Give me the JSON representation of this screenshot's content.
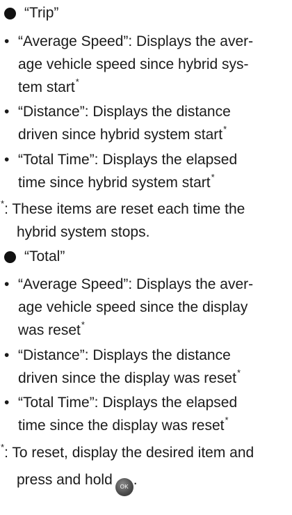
{
  "sections": [
    {
      "heading": "“Trip”",
      "items": [
        {
          "lines": [
            "“Average Speed”: Displays the aver-",
            "age vehicle speed since hybrid sys-",
            "tem start"
          ],
          "footnote_mark": "*"
        },
        {
          "lines": [
            "“Distance”: Displays the distance",
            "driven since hybrid system start"
          ],
          "footnote_mark": "*"
        },
        {
          "lines": [
            "“Total Time”: Displays the elapsed",
            "time since hybrid system start"
          ],
          "footnote_mark": "*"
        }
      ],
      "note": {
        "mark": "*",
        "lines": [
          ": These items are reset each time the",
          "hybrid system stops."
        ]
      }
    },
    {
      "heading": "“Total”",
      "items": [
        {
          "lines": [
            "“Average Speed”: Displays the aver-",
            "age vehicle speed since the display",
            "was reset"
          ],
          "footnote_mark": "*"
        },
        {
          "lines": [
            "“Distance”: Displays the distance",
            "driven since the display was reset"
          ],
          "footnote_mark": "*"
        },
        {
          "lines": [
            "“Total Time”: Displays the elapsed",
            "time since the display was reset"
          ],
          "footnote_mark": "*"
        }
      ],
      "note": {
        "mark": "*",
        "lines": [
          ": To reset, display the desired item and",
          "press and hold"
        ],
        "end_punct": ".",
        "button_label": "OK",
        "button_icon": "ok-button-icon"
      }
    }
  ],
  "bullet_char": "•",
  "colors": {
    "text": "#1a1a1a",
    "button": "#4a4a4a"
  }
}
